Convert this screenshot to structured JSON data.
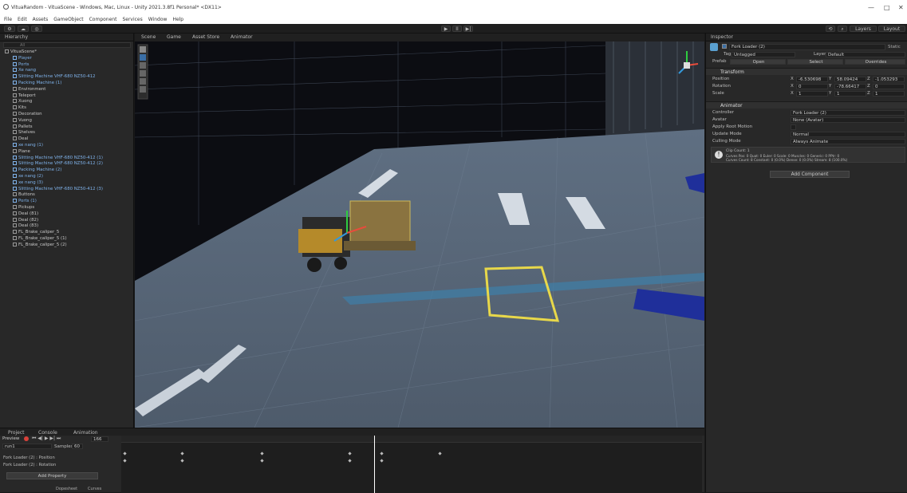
{
  "window": {
    "title": "VituaRandom - VituaScene - Windows, Mac, Linux - Unity 2021.3.8f1 Personal* <DX11>",
    "controls": [
      "—",
      "□",
      "✕"
    ]
  },
  "menu": [
    "File",
    "Edit",
    "Assets",
    "GameObject",
    "Component",
    "Services",
    "Window",
    "Help"
  ],
  "toolbar": {
    "play_controls": [
      "▶",
      "II",
      "▶|"
    ],
    "layers_label": "Layers",
    "layout_label": "Layout"
  },
  "hierarchy": {
    "tab_label": "Hierarchy",
    "search_placeholder": "All",
    "items": [
      {
        "label": "VituaScene*",
        "color": "white"
      },
      {
        "label": "Player",
        "color": "blue"
      },
      {
        "label": "Ports",
        "color": "blue"
      },
      {
        "label": "Xe nang",
        "color": "blue"
      },
      {
        "label": "Slitting Machine VHF-680 NZ50-412",
        "color": "blue"
      },
      {
        "label": "Packing Machine (1)",
        "color": "blue"
      },
      {
        "label": "Environment",
        "color": "white"
      },
      {
        "label": "Teleport",
        "color": "white"
      },
      {
        "label": "Xuong",
        "color": "white"
      },
      {
        "label": "Kits",
        "color": "white"
      },
      {
        "label": "Decoration",
        "color": "white"
      },
      {
        "label": "Vuong",
        "color": "white"
      },
      {
        "label": "Pallets",
        "color": "white"
      },
      {
        "label": "Shelves",
        "color": "white"
      },
      {
        "label": "Deal",
        "color": "white"
      },
      {
        "label": "xe nang (1)",
        "color": "blue"
      },
      {
        "label": "Plane",
        "color": "white"
      },
      {
        "label": "Slitting Machine VHF-680 NZ50-412 (1)",
        "color": "blue"
      },
      {
        "label": "Slitting Machine VHF-680 NZ50-412 (2)",
        "color": "blue"
      },
      {
        "label": "Packing Machine (2)",
        "color": "blue"
      },
      {
        "label": "xe nang (2)",
        "color": "blue"
      },
      {
        "label": "xe nang (3)",
        "color": "blue"
      },
      {
        "label": "Slitting Machine VHF-680 NZ50-412 (3)",
        "color": "blue"
      },
      {
        "label": "Buttons",
        "color": "white"
      },
      {
        "label": "Ports (1)",
        "color": "blue"
      },
      {
        "label": "Pickups",
        "color": "white"
      },
      {
        "label": "Deal (81)",
        "color": "white"
      },
      {
        "label": "Deal (82)",
        "color": "white"
      },
      {
        "label": "Deal (83)",
        "color": "white"
      },
      {
        "label": "FL_Brake_caliper_5",
        "color": "white"
      },
      {
        "label": "FL_Brake_caliper_5 (1)",
        "color": "white"
      },
      {
        "label": "FL_Brake_caliper_5 (2)",
        "color": "white"
      }
    ]
  },
  "scene_tabs": [
    "Scene",
    "Game",
    "Asset Store",
    "Animator"
  ],
  "inspector": {
    "tab_label": "Inspector",
    "object_name": "Fork Loader (2)",
    "static_label": "Static",
    "tag_label": "Tag",
    "tag_value": "Untagged",
    "layer_label": "Layer",
    "layer_value": "Default",
    "prefab_label": "Prefab",
    "prefab_buttons": [
      "Open",
      "Select",
      "Overrides"
    ],
    "transform": {
      "title": "Transform",
      "rows": [
        {
          "label": "Position",
          "x": "-6.530698",
          "y": "58.09424",
          "z": "-1.053293"
        },
        {
          "label": "Rotation",
          "x": "0",
          "y": "-78.66417",
          "z": "0"
        },
        {
          "label": "Scale",
          "x": "1",
          "y": "1",
          "z": "1"
        }
      ]
    },
    "animator": {
      "title": "Animator",
      "rows": [
        {
          "label": "Controller",
          "value": "Fork Loader (2)"
        },
        {
          "label": "Avatar",
          "value": "None (Avatar)"
        },
        {
          "label": "Apply Root Motion",
          "value": ""
        },
        {
          "label": "Update Mode",
          "value": "Normal"
        },
        {
          "label": "Culling Mode",
          "value": "Always Animate"
        }
      ],
      "info_lines": [
        "Clip Count: 1",
        "Curves Pos: 0 Quat: 0 Euler: 0 Scale: 0 Muscles: 0 Generic: 0 PPtr: 0",
        "Curves Count: 8 Constant: 0 (0.0%) Dense: 0 (0.0%) Stream: 8 (100.0%)"
      ]
    },
    "add_component_label": "Add Component"
  },
  "animation": {
    "tabs": [
      "Project",
      "Console",
      "Animation"
    ],
    "preview_label": "Preview",
    "frame_value": "166",
    "clip_name": "run1",
    "samples_label": "Samples",
    "samples_value": "60",
    "properties": [
      "Fork Loader (2) : Position",
      "Fork Loader (2) : Rotation"
    ],
    "add_property_label": "Add Property",
    "bottom_tabs": [
      "Dopesheet",
      "Curves"
    ]
  }
}
